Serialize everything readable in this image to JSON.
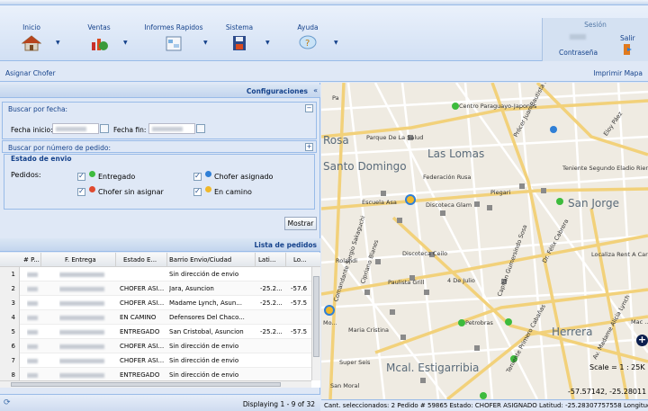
{
  "toolbar": {
    "buttons": [
      {
        "label": "Inicio",
        "icon": "home-icon"
      },
      {
        "label": "Ventas",
        "icon": "sales-chart-icon"
      },
      {
        "label": "Informes Rapidos",
        "icon": "reports-icon"
      },
      {
        "label": "Sistema",
        "icon": "save-disk-icon"
      },
      {
        "label": "Ayuda",
        "icon": "help-bubble-icon"
      }
    ]
  },
  "session": {
    "title": "Sesión",
    "password_label": "Contraseña",
    "logout_label": "Salir"
  },
  "actions": {
    "assign_driver": "Asignar Chofer",
    "print_map": "Imprimir Mapa"
  },
  "config": {
    "title": "Configuraciones",
    "by_date": "Buscar por fecha:",
    "start_label": "Fecha inicio:",
    "end_label": "Fecha fin:",
    "by_order": "Buscar por número de pedido:",
    "state_legend": "Estado de envio",
    "orders_label": "Pedidos:",
    "filters": [
      {
        "label": "Entregado",
        "color": "#3dbb3d",
        "checked": true
      },
      {
        "label": "Chofer asignado",
        "color": "#2f7fd6",
        "checked": true
      },
      {
        "label": "Chofer sin asignar",
        "color": "#e04a2f",
        "checked": true
      },
      {
        "label": "En camino",
        "color": "#f0b82a",
        "checked": true
      }
    ],
    "show_button": "Mostrar"
  },
  "orders": {
    "title": "Lista de pedidos",
    "columns": [
      "# P...",
      "F. Entrega",
      "Estado E...",
      "Barrio Envio/Ciudad",
      "Lati...",
      "Lo..."
    ],
    "rows": [
      {
        "n": "1",
        "estado": "",
        "barrio": "Sin dirección de envio",
        "lat": "",
        "lon": ""
      },
      {
        "n": "2",
        "estado": "CHOFER ASI...",
        "barrio": "Jara, Asuncion",
        "lat": "-25.2...",
        "lon": "-57.6"
      },
      {
        "n": "3",
        "estado": "CHOFER ASI...",
        "barrio": "Madame Lynch, Asun...",
        "lat": "-25.2...",
        "lon": "-57.5"
      },
      {
        "n": "4",
        "estado": "EN CAMINO",
        "barrio": "Defensores Del Chaco...",
        "lat": "",
        "lon": ""
      },
      {
        "n": "5",
        "estado": "ENTREGADO",
        "barrio": "San Cristobal, Asuncion",
        "lat": "-25.2...",
        "lon": "-57.5"
      },
      {
        "n": "6",
        "estado": "CHOFER ASI...",
        "barrio": "Sin dirección de envio",
        "lat": "",
        "lon": ""
      },
      {
        "n": "7",
        "estado": "CHOFER ASI...",
        "barrio": "Sin dirección de envio",
        "lat": "",
        "lon": ""
      },
      {
        "n": "8",
        "estado": "ENTREGADO",
        "barrio": "Sin dirección de envio",
        "lat": "",
        "lon": ""
      }
    ],
    "paging": "Displaying 1 - 9 of 32"
  },
  "map": {
    "labels": [
      {
        "text": "Centro Paraguayo-Japones",
        "size": "sm"
      },
      {
        "text": "Rosa",
        "size": "big"
      },
      {
        "text": "Las Lomas",
        "size": "big"
      },
      {
        "text": "Santo Domingo",
        "size": "big"
      },
      {
        "text": "San Jorge",
        "size": "big"
      },
      {
        "text": "Herrera",
        "size": "big"
      },
      {
        "text": "Mcal. Estigarribia",
        "size": "big"
      },
      {
        "text": "Parque De La Salud",
        "size": "sm"
      },
      {
        "text": "Federación Rusa",
        "size": "sm"
      },
      {
        "text": "Escuela Asa",
        "size": "sm"
      },
      {
        "text": "Discoteca Glam",
        "size": "sm"
      },
      {
        "text": "Piegari",
        "size": "sm"
      },
      {
        "text": "Discoteca Ceilo",
        "size": "sm"
      },
      {
        "text": "Paulista Grill",
        "size": "sm"
      },
      {
        "text": "4 De Julio",
        "size": "sm"
      },
      {
        "text": "Petrobras",
        "size": "sm"
      },
      {
        "text": "Maria Cristina",
        "size": "sm"
      },
      {
        "text": "Super Seis",
        "size": "sm"
      },
      {
        "text": "Rolandi",
        "size": "sm"
      },
      {
        "text": "San Moral",
        "size": "sm"
      },
      {
        "text": "Teniente Segundo Eladio Riera",
        "size": "sm"
      },
      {
        "text": "Localiza Rent A Car",
        "size": "sm"
      },
      {
        "text": "Prócer Juan Bautista Acosta",
        "size": "sm"
      },
      {
        "text": "Eloy Páez",
        "size": "sm"
      },
      {
        "text": "Dr. Félix Cabrera",
        "size": "sm"
      },
      {
        "text": "Capitán Gumersindo Sosa",
        "size": "sm"
      },
      {
        "text": "Comandante Sergio Sakaguchi",
        "size": "sm"
      },
      {
        "text": "Cipriano Blanes",
        "size": "sm"
      },
      {
        "text": "Av. Madame Alicia Lynch",
        "size": "sm"
      },
      {
        "text": "Teniente Primero Cabañas",
        "size": "sm"
      },
      {
        "text": "Mac ...",
        "size": "sm"
      },
      {
        "text": "Pa",
        "size": "sm"
      },
      {
        "text": "Mo...",
        "size": "sm"
      }
    ],
    "scale": "Scale = 1 : 25K",
    "coordinates": "-57.57142, -25.28011"
  },
  "status": {
    "text": "Cant. seleccionados: 2 Pedido # 59865 Estado: CHOFER ASIGNADO Latitud: -25.28307757558 Longitud"
  }
}
